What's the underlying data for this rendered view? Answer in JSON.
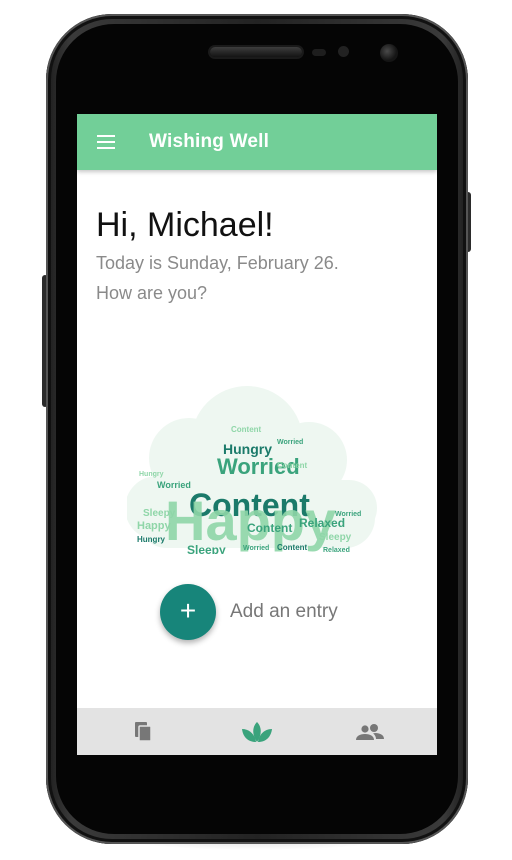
{
  "app": {
    "title": "Wishing Well"
  },
  "greeting": {
    "headline": "Hi, Michael!",
    "date_line": "Today is Sunday, February 26.",
    "question": "How are you?"
  },
  "mood_cloud": {
    "words": [
      "Happy",
      "Content",
      "Worried",
      "Hungry",
      "Relaxed",
      "Sleepy"
    ],
    "colors": {
      "dark": "#1b7a6a",
      "medium": "#3aa37c",
      "light": "#8fd6a8"
    }
  },
  "add_entry": {
    "icon": "+",
    "label": "Add an entry"
  },
  "bottom_nav": {
    "items": [
      {
        "icon": "copy-icon",
        "active": false
      },
      {
        "icon": "lotus-icon",
        "active": true
      },
      {
        "icon": "people-icon",
        "active": false
      }
    ]
  },
  "colors": {
    "appbar": "#72cf98",
    "fab": "#17857a",
    "nav_background": "#e3e3e3",
    "inactive_icon": "#777777"
  }
}
